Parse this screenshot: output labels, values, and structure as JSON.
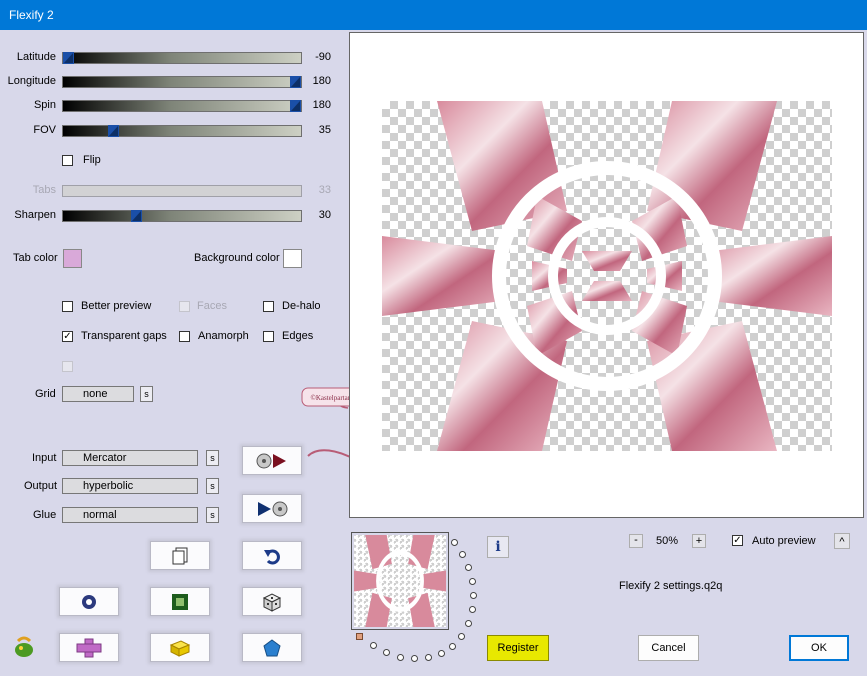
{
  "window": {
    "title": "Flexify 2"
  },
  "sliders": [
    {
      "label": "Latitude",
      "value": "-90",
      "level": 0.0
    },
    {
      "label": "Longitude",
      "value": "180",
      "level": 1.0
    },
    {
      "label": "Spin",
      "value": "180",
      "level": 1.0
    },
    {
      "label": "FOV",
      "value": "35",
      "level": 0.2
    },
    {
      "label": "Tabs",
      "value": "33",
      "level": 0.33
    },
    {
      "label": "Sharpen",
      "value": "30",
      "level": 0.3
    }
  ],
  "flip": {
    "label": "Flip",
    "checked": false
  },
  "colors": {
    "tab_color_label": "Tab color",
    "tab_color": "#d9a9d9",
    "background_color_label": "Background color",
    "background_color": "#ffffff"
  },
  "options": {
    "better_preview": "Better preview",
    "faces": "Faces",
    "de_halo": "De-halo",
    "transparent_gaps": "Transparent gaps",
    "anamorph": "Anamorph",
    "edges": "Edges"
  },
  "grid": {
    "label": "Grid",
    "value": "none",
    "s_label": "s"
  },
  "projection": {
    "input_label": "Input",
    "input_value": "Mercator",
    "output_label": "Output",
    "output_value": "hyperbolic",
    "glue_label": "Glue",
    "glue_value": "normal",
    "s_label": "s"
  },
  "watermark": {
    "text": "©Kastelpartan Wan"
  },
  "zoom": {
    "minus": "-",
    "value": "50%",
    "plus": "+"
  },
  "auto_preview": {
    "label": "Auto preview",
    "checked": true,
    "toggle": "^"
  },
  "settings_file": "Flexify 2 settings.q2q",
  "buttons": {
    "register": "Register",
    "cancel": "Cancel",
    "ok": "OK",
    "info": "i"
  },
  "accent_colors": {
    "title_bar": "#0078d7",
    "dialog_bg": "#d8d8ea",
    "register_bg": "#e8e800",
    "ok_border": "#0078d7",
    "petal": "#c97a8c"
  }
}
